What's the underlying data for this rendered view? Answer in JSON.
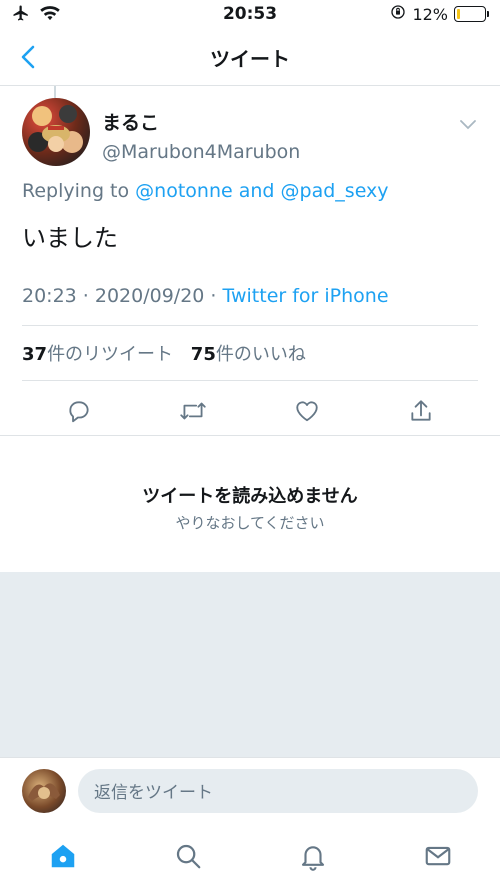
{
  "status_bar": {
    "time": "20:53",
    "battery_percent": "12%",
    "battery_level": 0.12
  },
  "nav": {
    "title": "ツイート",
    "back_icon": "chevron-left-icon"
  },
  "tweet": {
    "display_name": "まるこ",
    "handle": "@Marubon4Marubon",
    "replying_prefix": "Replying to",
    "mention_1": "@notonne",
    "replying_and": "and",
    "mention_2": "@pad_sexy",
    "text": "いました",
    "timestamp": "20:23 · 2020/09/20 · ",
    "source": "Twitter for iPhone",
    "retweet_count": "37",
    "retweet_label": "件のリツイート",
    "like_count": "75",
    "like_label": "件のいいね"
  },
  "error": {
    "title": "ツイートを読み込めません",
    "subtitle": "やりなおしてください"
  },
  "reply_bar": {
    "placeholder": "返信をツイート"
  },
  "colors": {
    "accent": "#1da1f2",
    "text_secondary": "#657786",
    "divider": "#dfe3e6",
    "grey_bg": "#e6ecf0"
  }
}
